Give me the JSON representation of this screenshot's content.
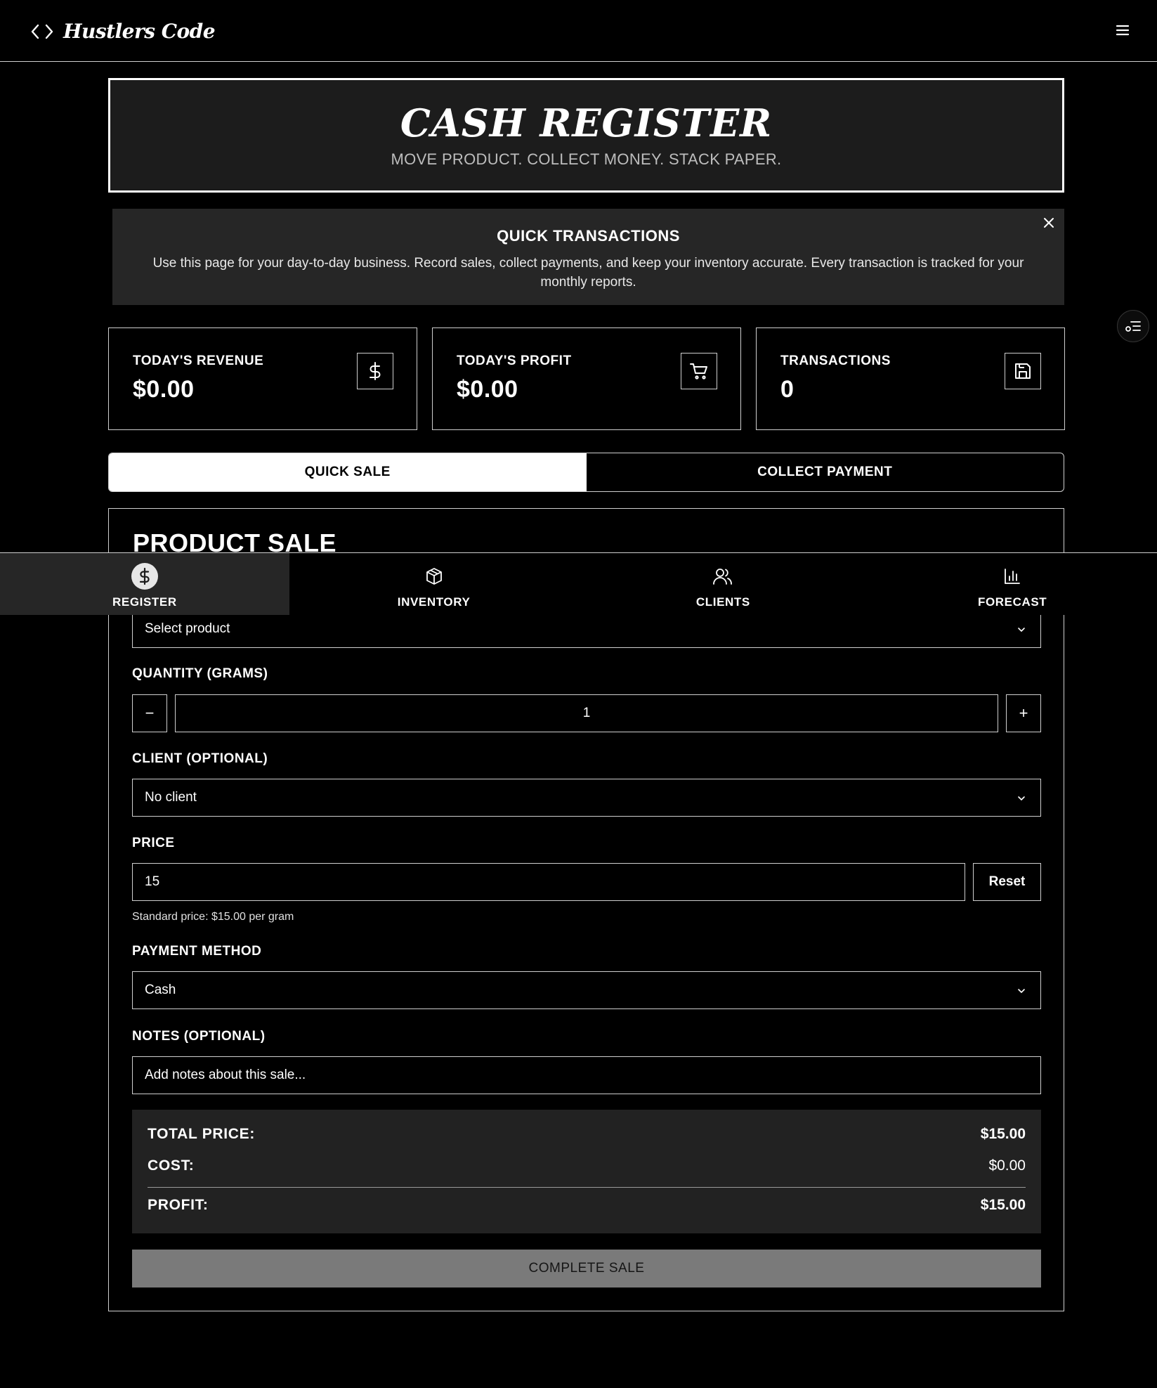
{
  "app": {
    "name": "Hustlers Code"
  },
  "hero": {
    "title": "CASH REGISTER",
    "subtitle": "MOVE PRODUCT. COLLECT MONEY. STACK PAPER."
  },
  "info": {
    "title": "QUICK TRANSACTIONS",
    "text": "Use this page for your day-to-day business. Record sales, collect payments, and keep your inventory accurate. Every transaction is tracked for your monthly reports."
  },
  "stats": [
    {
      "label": "TODAY'S REVENUE",
      "value": "$0.00",
      "icon": "dollar-icon"
    },
    {
      "label": "TODAY'S PROFIT",
      "value": "$0.00",
      "icon": "cart-icon"
    },
    {
      "label": "TRANSACTIONS",
      "value": "0",
      "icon": "save-icon"
    }
  ],
  "tabs": [
    {
      "label": "QUICK SALE",
      "active": true
    },
    {
      "label": "COLLECT PAYMENT",
      "active": false
    }
  ],
  "sale": {
    "title": "PRODUCT SALE",
    "product": {
      "value": "Select product"
    },
    "quantity": {
      "label": "QUANTITY (GRAMS)",
      "value": "1",
      "minus": "−",
      "plus": "+"
    },
    "client": {
      "label": "CLIENT (OPTIONAL)",
      "value": "No client"
    },
    "price": {
      "label": "PRICE",
      "value": "15",
      "reset_label": "Reset",
      "hint": "Standard price: $15.00 per gram"
    },
    "payment": {
      "label": "PAYMENT METHOD",
      "value": "Cash"
    },
    "notes": {
      "label": "NOTES (OPTIONAL)",
      "placeholder": "Add notes about this sale..."
    },
    "summary": {
      "total_label": "TOTAL PRICE:",
      "total_value": "$15.00",
      "cost_label": "COST:",
      "cost_value": "$0.00",
      "profit_label": "PROFIT:",
      "profit_value": "$15.00"
    },
    "complete_label": "COMPLETE SALE"
  },
  "bottom_nav": [
    {
      "label": "REGISTER",
      "icon": "dollar-icon",
      "active": true
    },
    {
      "label": "INVENTORY",
      "icon": "box-icon",
      "active": false
    },
    {
      "label": "CLIENTS",
      "icon": "users-icon",
      "active": false
    },
    {
      "label": "FORECAST",
      "icon": "bar-chart-icon",
      "active": false
    }
  ]
}
